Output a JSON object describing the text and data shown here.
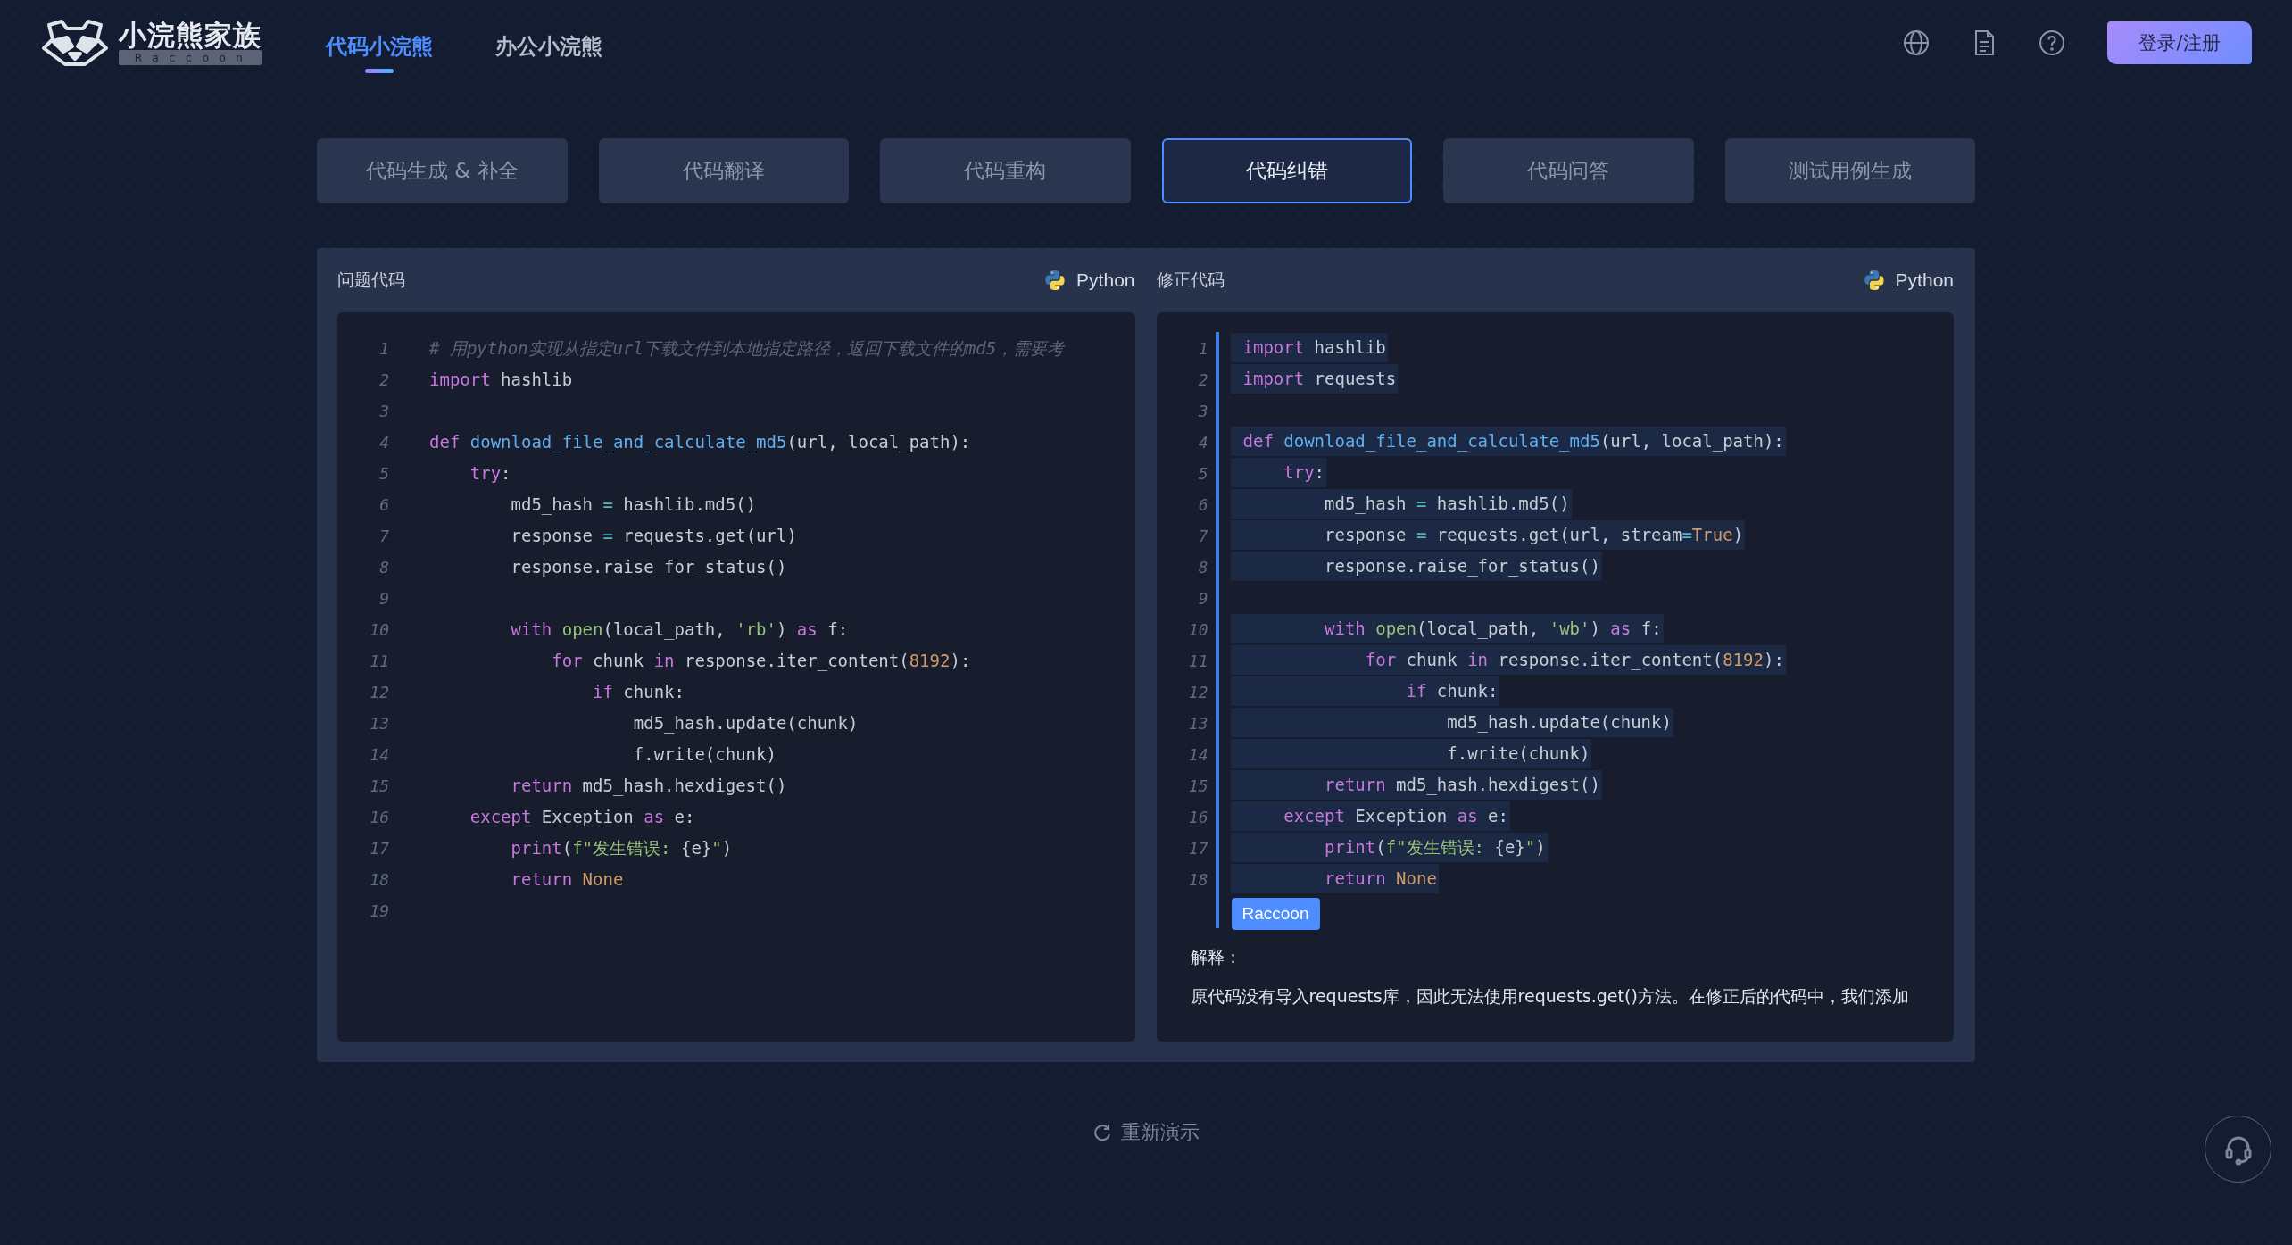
{
  "header": {
    "logo_title": "小浣熊家族",
    "logo_subtitle": "Raccoon",
    "nav": [
      {
        "label": "代码小浣熊",
        "selected": true
      },
      {
        "label": "办公小浣熊",
        "selected": false
      }
    ],
    "login_button": "登录/注册"
  },
  "function_tabs": [
    {
      "label": "代码生成 & 补全",
      "selected": false
    },
    {
      "label": "代码翻译",
      "selected": false
    },
    {
      "label": "代码重构",
      "selected": false
    },
    {
      "label": "代码纠错",
      "selected": true
    },
    {
      "label": "代码问答",
      "selected": false
    },
    {
      "label": "测试用例生成",
      "selected": false
    }
  ],
  "panels": [
    {
      "title": "问题代码",
      "language": "Python",
      "lines": [
        {
          "number": "1",
          "tokens": [
            {
              "kind": "comment",
              "text": "# 用python实现从指定url下载文件到本地指定路径，返回下载文件的md5，需要考"
            }
          ]
        },
        {
          "number": "2",
          "tokens": [
            {
              "kind": "keyword",
              "text": "import"
            },
            {
              "kind": "plain",
              "text": " hashlib"
            }
          ]
        },
        {
          "number": "3"
        },
        {
          "number": "4",
          "tokens": [
            {
              "kind": "keyword",
              "text": "def "
            },
            {
              "kind": "function",
              "text": "download_file_and_calculate_md5"
            },
            {
              "kind": "plain",
              "text": "(url, local_path):"
            }
          ]
        },
        {
          "number": "5",
          "tokens": [
            {
              "kind": "keyword",
              "text": "    try"
            },
            {
              "kind": "plain",
              "text": ":"
            }
          ]
        },
        {
          "number": "6",
          "tokens": [
            {
              "kind": "plain",
              "text": "        md5_hash "
            },
            {
              "kind": "operator",
              "text": "="
            },
            {
              "kind": "plain",
              "text": " hashlib.md5()"
            }
          ]
        },
        {
          "number": "7",
          "tokens": [
            {
              "kind": "plain",
              "text": "        response "
            },
            {
              "kind": "operator",
              "text": "="
            },
            {
              "kind": "plain",
              "text": " requests.get(url)"
            }
          ]
        },
        {
          "number": "8",
          "tokens": [
            {
              "kind": "plain",
              "text": "        response.raise_for_status()"
            }
          ]
        },
        {
          "number": "9"
        },
        {
          "number": "10",
          "tokens": [
            {
              "kind": "keyword",
              "text": "        with "
            },
            {
              "kind": "builtin",
              "text": "open"
            },
            {
              "kind": "plain",
              "text": "(local_path, "
            },
            {
              "kind": "string",
              "text": "'rb'"
            },
            {
              "kind": "plain",
              "text": ") "
            },
            {
              "kind": "keyword",
              "text": "as"
            },
            {
              "kind": "plain",
              "text": " f:"
            }
          ]
        },
        {
          "number": "11",
          "tokens": [
            {
              "kind": "keyword",
              "text": "            for"
            },
            {
              "kind": "plain",
              "text": " chunk "
            },
            {
              "kind": "keyword",
              "text": "in"
            },
            {
              "kind": "plain",
              "text": " response.iter_content("
            },
            {
              "kind": "number",
              "text": "8192"
            },
            {
              "kind": "plain",
              "text": "):"
            }
          ]
        },
        {
          "number": "12",
          "tokens": [
            {
              "kind": "keyword",
              "text": "                if"
            },
            {
              "kind": "plain",
              "text": " chunk:"
            }
          ]
        },
        {
          "number": "13",
          "tokens": [
            {
              "kind": "plain",
              "text": "                    md5_hash.update(chunk)"
            }
          ]
        },
        {
          "number": "14",
          "tokens": [
            {
              "kind": "plain",
              "text": "                    f.write(chunk)"
            }
          ]
        },
        {
          "number": "15",
          "tokens": [
            {
              "kind": "keyword",
              "text": "        return"
            },
            {
              "kind": "plain",
              "text": " md5_hash.hexdigest()"
            }
          ]
        },
        {
          "number": "16",
          "tokens": [
            {
              "kind": "keyword",
              "text": "    except"
            },
            {
              "kind": "plain",
              "text": " Exception "
            },
            {
              "kind": "keyword",
              "text": "as"
            },
            {
              "kind": "plain",
              "text": " e:"
            }
          ]
        },
        {
          "number": "17",
          "tokens": [
            {
              "kind": "keyword",
              "text": "        print"
            },
            {
              "kind": "plain",
              "text": "("
            },
            {
              "kind": "string",
              "text": "f\"发生错误: "
            },
            {
              "kind": "plain",
              "text": "{e}"
            },
            {
              "kind": "string",
              "text": "\""
            },
            {
              "kind": "plain",
              "text": ")"
            }
          ]
        },
        {
          "number": "18",
          "tokens": [
            {
              "kind": "keyword",
              "text": "        return "
            },
            {
              "kind": "constant",
              "text": "None"
            }
          ]
        },
        {
          "number": "19"
        }
      ]
    },
    {
      "title": "修正代码",
      "language": "Python",
      "lines": [
        {
          "number": "1",
          "highlighted": true,
          "tokens": [
            {
              "kind": "keyword",
              "text": "import"
            },
            {
              "kind": "plain",
              "text": " hashlib"
            }
          ]
        },
        {
          "number": "2",
          "highlighted": true,
          "tokens": [
            {
              "kind": "keyword",
              "text": "import"
            },
            {
              "kind": "plain",
              "text": " requests"
            }
          ]
        },
        {
          "number": "3"
        },
        {
          "number": "4",
          "highlighted": true,
          "tokens": [
            {
              "kind": "keyword",
              "text": "def "
            },
            {
              "kind": "function",
              "text": "download_file_and_calculate_md5"
            },
            {
              "kind": "plain",
              "text": "(url, local_path):"
            }
          ]
        },
        {
          "number": "5",
          "highlighted": true,
          "tokens": [
            {
              "kind": "keyword",
              "text": "    try"
            },
            {
              "kind": "plain",
              "text": ":"
            }
          ]
        },
        {
          "number": "6",
          "highlighted": true,
          "tokens": [
            {
              "kind": "plain",
              "text": "        md5_hash "
            },
            {
              "kind": "operator",
              "text": "="
            },
            {
              "kind": "plain",
              "text": " hashlib.md5()"
            }
          ]
        },
        {
          "number": "7",
          "highlighted": true,
          "tokens": [
            {
              "kind": "plain",
              "text": "        response "
            },
            {
              "kind": "operator",
              "text": "="
            },
            {
              "kind": "plain",
              "text": " requests.get(url, stream"
            },
            {
              "kind": "operator",
              "text": "="
            },
            {
              "kind": "constant",
              "text": "True"
            },
            {
              "kind": "plain",
              "text": ")"
            }
          ]
        },
        {
          "number": "8",
          "highlighted": true,
          "tokens": [
            {
              "kind": "plain",
              "text": "        response.raise_for_status()"
            }
          ]
        },
        {
          "number": "9"
        },
        {
          "number": "10",
          "highlighted": true,
          "tokens": [
            {
              "kind": "keyword",
              "text": "        with "
            },
            {
              "kind": "builtin",
              "text": "open"
            },
            {
              "kind": "plain",
              "text": "(local_path, "
            },
            {
              "kind": "string",
              "text": "'wb'"
            },
            {
              "kind": "plain",
              "text": ") "
            },
            {
              "kind": "keyword",
              "text": "as"
            },
            {
              "kind": "plain",
              "text": " f:"
            }
          ]
        },
        {
          "number": "11",
          "highlighted": true,
          "tokens": [
            {
              "kind": "keyword",
              "text": "            for"
            },
            {
              "kind": "plain",
              "text": " chunk "
            },
            {
              "kind": "keyword",
              "text": "in"
            },
            {
              "kind": "plain",
              "text": " response.iter_content("
            },
            {
              "kind": "number",
              "text": "8192"
            },
            {
              "kind": "plain",
              "text": "):"
            }
          ]
        },
        {
          "number": "12",
          "highlighted": true,
          "tokens": [
            {
              "kind": "keyword",
              "text": "                if"
            },
            {
              "kind": "plain",
              "text": " chunk:"
            }
          ]
        },
        {
          "number": "13",
          "highlighted": true,
          "tokens": [
            {
              "kind": "plain",
              "text": "                    md5_hash.update(chunk)"
            }
          ]
        },
        {
          "number": "14",
          "highlighted": true,
          "tokens": [
            {
              "kind": "plain",
              "text": "                    f.write(chunk)"
            }
          ]
        },
        {
          "number": "15",
          "highlighted": true,
          "tokens": [
            {
              "kind": "keyword",
              "text": "        return"
            },
            {
              "kind": "plain",
              "text": " md5_hash.hexdigest()"
            }
          ]
        },
        {
          "number": "16",
          "highlighted": true,
          "tokens": [
            {
              "kind": "keyword",
              "text": "    except"
            },
            {
              "kind": "plain",
              "text": " Exception "
            },
            {
              "kind": "keyword",
              "text": "as"
            },
            {
              "kind": "plain",
              "text": " e:"
            }
          ]
        },
        {
          "number": "17",
          "highlighted": true,
          "tokens": [
            {
              "kind": "keyword",
              "text": "        print"
            },
            {
              "kind": "plain",
              "text": "("
            },
            {
              "kind": "string",
              "text": "f\"发生错误: "
            },
            {
              "kind": "plain",
              "text": "{e}"
            },
            {
              "kind": "string",
              "text": "\""
            },
            {
              "kind": "plain",
              "text": ")"
            }
          ]
        },
        {
          "number": "18",
          "highlighted": true,
          "tokens": [
            {
              "kind": "keyword",
              "text": "        return "
            },
            {
              "kind": "constant",
              "text": "None"
            }
          ]
        }
      ],
      "tag": "Raccoon",
      "explanation_heading": "解释：",
      "explanation": "原代码没有导入requests库，因此无法使用requests.get()方法。在修正后的代码中，我们添加"
    }
  ],
  "replay_button": "重新演示"
}
